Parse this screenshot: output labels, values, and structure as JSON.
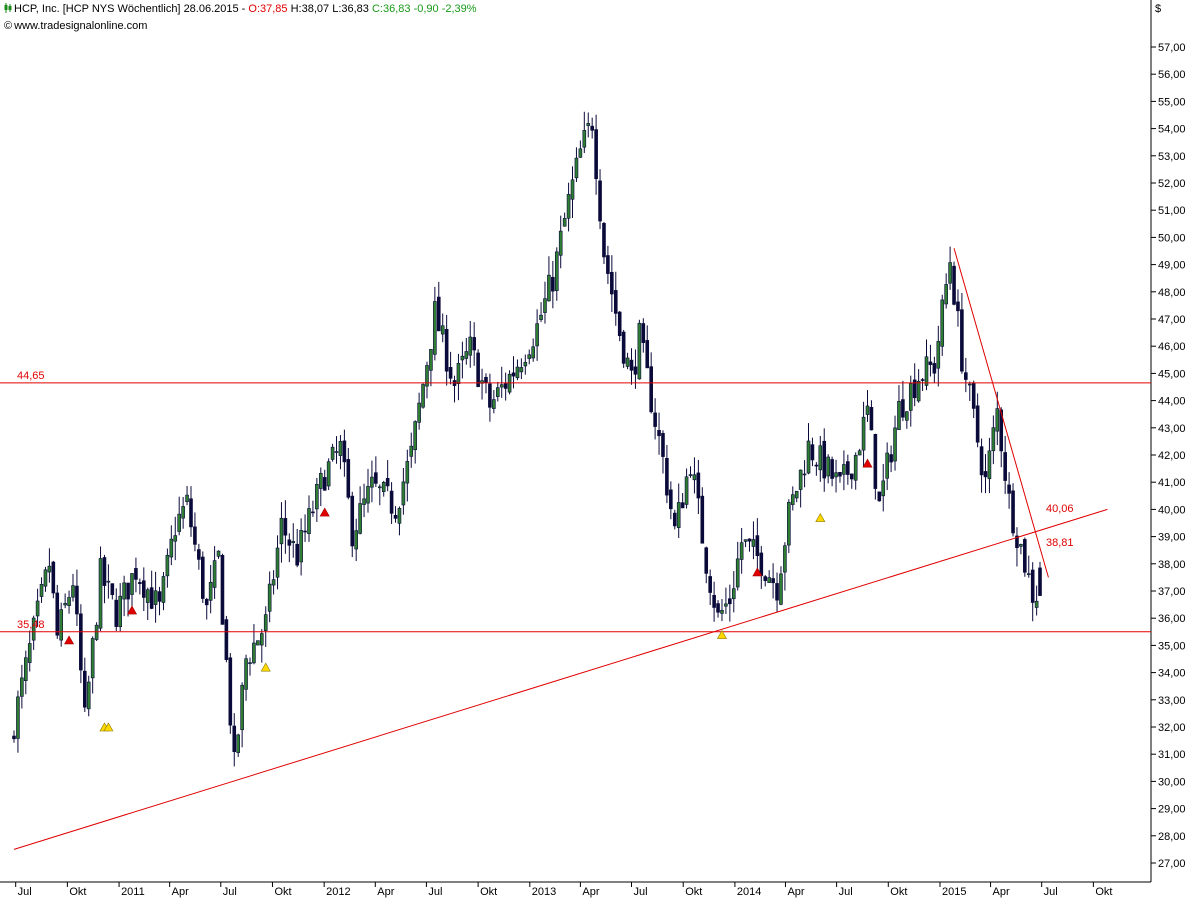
{
  "header": {
    "instrument": "HCP, Inc. [HCP NYS  Wöchentlich]",
    "date": "28.06.2015",
    "open": "O:37,85",
    "high": "H:38,07",
    "low": "L:36,83",
    "close": "C:36,83",
    "change": "-0,90",
    "change_pct": "-2,39%",
    "source": "www.tradesignalonline.com",
    "currency": "$",
    "colors": {
      "down": "#e00000",
      "up": "#1a9a1a",
      "chart_icon": "#1a8a1a"
    }
  },
  "chart_data": {
    "type": "candlestick",
    "title": "HCP, Inc. [HCP NYS  Wöchentlich]",
    "interval": "weekly",
    "y_axis": {
      "side": "right",
      "min": 26.0,
      "max": 58.0,
      "tick_step": 1,
      "tick_labels": [
        "27,00",
        "28,00",
        "29,00",
        "30,00",
        "31,00",
        "32,00",
        "33,00",
        "34,00",
        "35,00",
        "36,00",
        "37,00",
        "38,00",
        "39,00",
        "40,00",
        "41,00",
        "42,00",
        "43,00",
        "44,00",
        "45,00",
        "46,00",
        "47,00",
        "48,00",
        "49,00",
        "50,00",
        "51,00",
        "52,00",
        "53,00",
        "54,00",
        "55,00",
        "56,00",
        "57,00"
      ]
    },
    "x_axis": {
      "tick_labels": [
        {
          "label": "Jul",
          "date": "2010-07"
        },
        {
          "label": "Okt",
          "date": "2010-10"
        },
        {
          "label": "2011",
          "date": "2011-01"
        },
        {
          "label": "Apr",
          "date": "2011-04"
        },
        {
          "label": "Jul",
          "date": "2011-07"
        },
        {
          "label": "Okt",
          "date": "2011-10"
        },
        {
          "label": "2012",
          "date": "2012-01"
        },
        {
          "label": "Apr",
          "date": "2012-04"
        },
        {
          "label": "Jul",
          "date": "2012-07"
        },
        {
          "label": "Okt",
          "date": "2012-10"
        },
        {
          "label": "2013",
          "date": "2013-01"
        },
        {
          "label": "Apr",
          "date": "2013-04"
        },
        {
          "label": "Jul",
          "date": "2013-07"
        },
        {
          "label": "Okt",
          "date": "2013-10"
        },
        {
          "label": "2014",
          "date": "2014-01"
        },
        {
          "label": "Apr",
          "date": "2014-04"
        },
        {
          "label": "Jul",
          "date": "2014-07"
        },
        {
          "label": "Okt",
          "date": "2014-10"
        },
        {
          "label": "2015",
          "date": "2015-01"
        },
        {
          "label": "Apr",
          "date": "2015-04"
        },
        {
          "label": "Jul",
          "date": "2015-07"
        },
        {
          "label": "Okt",
          "date": "2015-10"
        }
      ]
    },
    "grid": false,
    "price_path": [
      [
        "2010-06-28",
        31.5
      ],
      [
        "2010-08-09",
        35.5
      ],
      [
        "2010-09-06",
        38.0
      ],
      [
        "2010-09-20",
        35.3
      ],
      [
        "2010-10-18",
        37.4
      ],
      [
        "2010-11-08",
        32.2
      ],
      [
        "2010-12-06",
        37.6
      ],
      [
        "2011-01-03",
        36.2
      ],
      [
        "2011-02-07",
        37.8
      ],
      [
        "2011-03-21",
        36.3
      ],
      [
        "2011-04-18",
        39.4
      ],
      [
        "2011-05-09",
        40.2
      ],
      [
        "2011-06-13",
        36.3
      ],
      [
        "2011-07-04",
        38.2
      ],
      [
        "2011-08-01",
        30.5
      ],
      [
        "2011-08-22",
        34.5
      ],
      [
        "2011-09-26",
        35.8
      ],
      [
        "2011-10-24",
        39.4
      ],
      [
        "2011-11-21",
        38.3
      ],
      [
        "2012-01-09",
        41.3
      ],
      [
        "2012-02-06",
        42.2
      ],
      [
        "2012-02-27",
        39.2
      ],
      [
        "2012-04-02",
        40.8
      ],
      [
        "2012-05-14",
        40.1
      ],
      [
        "2012-06-11",
        42.0
      ],
      [
        "2012-07-02",
        44.6
      ],
      [
        "2012-07-23",
        47.2
      ],
      [
        "2012-08-27",
        44.6
      ],
      [
        "2012-09-24",
        45.9
      ],
      [
        "2012-10-29",
        43.8
      ],
      [
        "2012-12-10",
        45.1
      ],
      [
        "2013-01-21",
        46.7
      ],
      [
        "2013-02-18",
        48.5
      ],
      [
        "2013-03-18",
        51.3
      ],
      [
        "2013-04-08",
        53.1
      ],
      [
        "2013-04-29",
        54.3
      ],
      [
        "2013-05-20",
        49.5
      ],
      [
        "2013-06-17",
        46.5
      ],
      [
        "2013-07-08",
        44.8
      ],
      [
        "2013-07-22",
        46.3
      ],
      [
        "2013-09-02",
        41.8
      ],
      [
        "2013-09-23",
        39.2
      ],
      [
        "2013-10-21",
        41.8
      ],
      [
        "2013-11-18",
        38.1
      ],
      [
        "2013-12-09",
        36.0
      ],
      [
        "2013-12-30",
        36.7
      ],
      [
        "2014-01-20",
        38.8
      ],
      [
        "2014-02-24",
        38.1
      ],
      [
        "2014-03-24",
        37.2
      ],
      [
        "2014-04-14",
        39.8
      ],
      [
        "2014-05-19",
        42.3
      ],
      [
        "2014-06-16",
        41.6
      ],
      [
        "2014-07-14",
        40.8
      ],
      [
        "2014-08-11",
        42.0
      ],
      [
        "2014-09-01",
        43.6
      ],
      [
        "2014-09-22",
        40.1
      ],
      [
        "2014-10-27",
        43.7
      ],
      [
        "2014-12-01",
        44.9
      ],
      [
        "2014-12-29",
        45.3
      ],
      [
        "2015-01-26",
        49.2
      ],
      [
        "2015-02-16",
        45.6
      ],
      [
        "2015-03-09",
        43.3
      ],
      [
        "2015-03-30",
        41.0
      ],
      [
        "2015-04-20",
        43.6
      ],
      [
        "2015-05-11",
        40.3
      ],
      [
        "2015-06-01",
        38.6
      ],
      [
        "2015-06-22",
        36.9
      ]
    ],
    "last_bar": {
      "date": "2015-06-28",
      "open": 37.85,
      "high": 38.07,
      "low": 36.83,
      "close": 36.83
    },
    "lines": [
      {
        "kind": "horizontal",
        "value": 44.65,
        "label": "44,65",
        "color": "#e00000"
      },
      {
        "kind": "horizontal",
        "value": 35.5,
        "label": "35,48",
        "color": "#e00000"
      },
      {
        "kind": "trend",
        "from": [
          "2010-06-28",
          27.5
        ],
        "to": [
          "2015-10-26",
          40.0
        ],
        "label": "38,81",
        "label_value": 38.81,
        "color": "#e00000"
      },
      {
        "kind": "trend",
        "from": [
          "2015-01-26",
          49.6
        ],
        "to": [
          "2015-07-13",
          37.5
        ],
        "label": "40,06",
        "label_value": 40.06,
        "color": "#e00000"
      }
    ],
    "markers": [
      {
        "date": "2010-10-04",
        "price": 35.2,
        "shape": "triangle-up",
        "color": "#e00000"
      },
      {
        "date": "2010-12-06",
        "price": 32.0,
        "shape": "triangle-up",
        "color": "#ffd800"
      },
      {
        "date": "2010-12-13",
        "price": 32.0,
        "shape": "triangle-up",
        "color": "#ffd800"
      },
      {
        "date": "2011-01-24",
        "price": 36.3,
        "shape": "triangle-up",
        "color": "#e00000"
      },
      {
        "date": "2011-09-19",
        "price": 34.2,
        "shape": "triangle-up",
        "color": "#ffd800"
      },
      {
        "date": "2012-01-02",
        "price": 39.9,
        "shape": "triangle-up",
        "color": "#e00000"
      },
      {
        "date": "2013-12-09",
        "price": 35.4,
        "shape": "triangle-up",
        "color": "#ffd800"
      },
      {
        "date": "2014-02-10",
        "price": 37.7,
        "shape": "triangle-up",
        "color": "#e00000"
      },
      {
        "date": "2014-06-02",
        "price": 39.7,
        "shape": "triangle-up",
        "color": "#ffd800"
      },
      {
        "date": "2014-08-25",
        "price": 41.7,
        "shape": "triangle-up",
        "color": "#e00000"
      }
    ],
    "candle_colors": {
      "up": "#2e7d32",
      "down": "#0a0a3a",
      "wick": "#0a0a3a"
    }
  }
}
